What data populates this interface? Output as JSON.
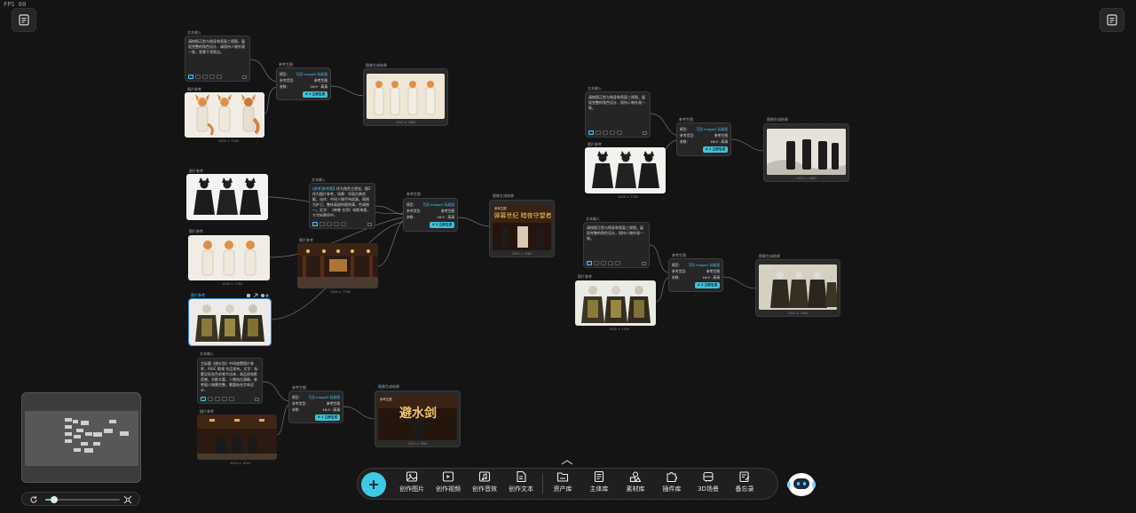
{
  "app": {
    "fps": "FPS 60"
  },
  "labels": {
    "text_input": "文本输入",
    "image_ref": "图片参考",
    "gen_settings": "参考生图",
    "gen_result": "图像生成结果",
    "ref_image_badge": "参考生图"
  },
  "gen_fields": {
    "model_key": "模型:",
    "model_val": "可灵 image2 标准版",
    "type_key": "参考类型:",
    "type_val": "参考生图",
    "params_key": "参数:",
    "params_val": "16:9 · 高清",
    "button": "⊕ 1 立即生成"
  },
  "texts": {
    "t1": "请按照正脸与侧身和背面三视图，展现完整的角色设计，请保持人物外观一致，背景干净简洁。",
    "t2a": "(参考)参考图",
    "t2b": "1 作为角色主视觉，图2作为图片参考。场景：华丽古典宫殿，动作：中间人物手持武器，两侧为护卫。整体画面构图饱满，色调统一。文字：《神兽 名剑》电影海报，大字标题居中。",
    "t3": "主标题《避水剑》中间放置图片参考，AIGC 影视 作品发布。文字：标题呈现金色毛笔书法体，高品质电影质感，光影丰富，人物站位清晰，参考图人物需完整，需要结合字体设计。",
    "t4": "请按照正脸与侧身和背面三视图，展现完整的角色设计，保持人物外观一致。",
    "t5": "请按照正脸与侧身和背面三视图，展现完整的角色设计，保持人物外观一致。"
  },
  "sizes": {
    "fox1": "1500 × 7780",
    "wolf1": "1500 × 7780",
    "fox2": "1500 × 7780",
    "palace": "1500 × 7780",
    "tiger": "1500 × 7780",
    "cinema": "1024 × 1024",
    "out1": "1920 × 7680",
    "out2": "1920 × 1080",
    "out3": "1920 × 1080",
    "out4": "1920 × 1080",
    "out5": "1920 × 1080",
    "wolf2": "1500 × 7780",
    "tiger2": "1500 × 7780"
  },
  "posters": {
    "p1": "弹幕世纪 暗夜守望者",
    "p2": "避水剑"
  },
  "toolbar": {
    "items": [
      "创作图片",
      "创作视频",
      "创作音效",
      "创作文本",
      "资产库",
      "主体库",
      "素材库",
      "插件库",
      "3D场景",
      "备忘录"
    ]
  },
  "colors": {
    "accent": "#3ccae6",
    "link": "#4fc3f7",
    "bg": "#141414"
  },
  "zoom": {
    "level": 0.12
  }
}
